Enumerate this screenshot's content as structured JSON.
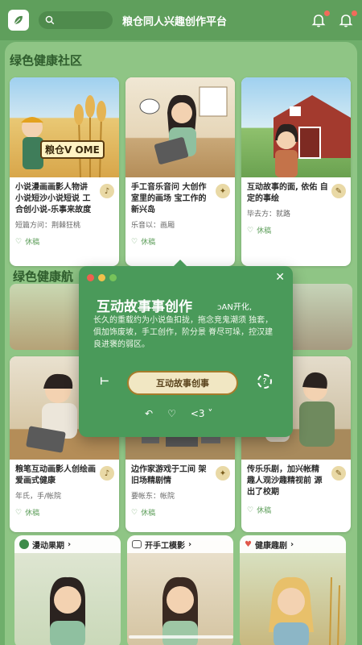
{
  "header": {
    "title": "粮仓同人兴趣创作平台",
    "search_placeholder": ""
  },
  "sections": {
    "community_title": "绿色健康社区",
    "community_title_2": "绿色健康航"
  },
  "top_cards": [
    {
      "title": "小说漫画画影人物讲 小说短沙小说短说 工合创小说-乐事来故度",
      "meta": "短篇方问：荆棘狂桃",
      "likes": "休稿",
      "badge": "♪",
      "poster_text": "粮仓V OME"
    },
    {
      "title": "手工音乐音问 大创作室里的画场 宝工作的新兴岛",
      "meta": "乐音以：画厢",
      "likes": "休稿",
      "badge": "✦"
    },
    {
      "title": "互动故事的面, 依佑 自定的事绘",
      "meta": "毕去方：就路",
      "likes": "休稿",
      "badge": "✎"
    }
  ],
  "mid_cards": [
    {
      "title": "粮笔互动画影人创绘画 爱画式健康",
      "meta": "年氏，手/帐院",
      "likes": "休稿",
      "badge": "♪"
    },
    {
      "title": "边作家游戏于工间 架旧场精剧情",
      "meta": "要帐东：帐院",
      "likes": "休稿",
      "badge": "✦"
    },
    {
      "title": "传乐乐剧，加兴帐精 趣人观沙趣精视前 源出了校期",
      "meta": "",
      "likes": "休稿",
      "badge": "✎"
    }
  ],
  "bottom_cards": [
    {
      "label": "漫动果期",
      "icon": "leaf"
    },
    {
      "label": "开手工模影",
      "icon": "chat"
    },
    {
      "label": "健康趣剧",
      "icon": "heart"
    }
  ],
  "popup": {
    "title": "互动故事事创作",
    "subtitle": "ɔAN开化,",
    "description": "长久的重载约为小说鱼扣拢，拖念竞鬼潮须 独套，俱加饰废坡，手工创作，阶分景 脊尽可垛，控汉建良进褒的弱区。",
    "button_label": "互动故事创事",
    "left_icon": "⊢",
    "actions": [
      "↶",
      "♡",
      "<3 ˅"
    ]
  },
  "colors": {
    "header": "#5f9f5c",
    "panel": "#8fc585",
    "popup": "#4a9a5a",
    "accent": "#a67c2b"
  }
}
